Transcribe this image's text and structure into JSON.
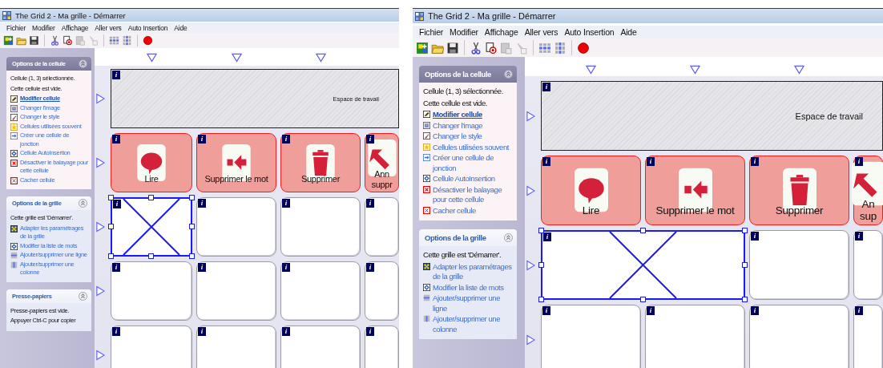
{
  "windows": [
    {
      "title": "The Grid 2 - Ma grille - Démarrer",
      "menu": [
        "Fichier",
        "Modifier",
        "Affichage",
        "Aller vers",
        "Auto Insertion",
        "Aide"
      ],
      "toolbar": [
        [
          {
            "kind": "new",
            "disabled": false
          },
          {
            "kind": "open",
            "disabled": false
          },
          {
            "kind": "save",
            "disabled": false
          }
        ],
        [
          {
            "kind": "cut",
            "disabled": false
          },
          {
            "kind": "copy",
            "disabled": false
          },
          {
            "kind": "paste",
            "disabled": true
          },
          {
            "kind": "paste-special",
            "disabled": true
          }
        ],
        [
          {
            "kind": "rows",
            "disabled": false
          },
          {
            "kind": "columns",
            "disabled": false
          }
        ],
        [
          {
            "kind": "record",
            "disabled": false
          }
        ]
      ],
      "panels": [
        {
          "title": "Options de la cellule",
          "highlighted": true,
          "lines": [
            {
              "kind": "text",
              "text": "Cellule (1, 3) sélectionnée."
            },
            {
              "kind": "text",
              "text": "Cette cellule est vide."
            },
            {
              "kind": "pencil",
              "text": "Modifier cellule",
              "bold": true
            },
            {
              "kind": "picture",
              "text": "Changer l'image",
              "bold": false
            },
            {
              "kind": "brush",
              "text": "Changer le style",
              "bold": false
            },
            {
              "kind": "star",
              "text": "Cellules utilisées souvent",
              "bold": false
            },
            {
              "kind": "arrow",
              "text": "Créer une cellule de jonction",
              "bold": false
            },
            {
              "kind": "diamond",
              "text": "Cellule AutoInsertion",
              "bold": false
            },
            {
              "kind": "cross-red",
              "text": "Désactiver le balayage pour cette cellule",
              "bold": false
            },
            {
              "kind": "cross-grey",
              "text": "Cacher cellule",
              "bold": false
            }
          ]
        },
        {
          "title": "Options de la grille",
          "highlighted": false,
          "lines": [
            {
              "kind": "text",
              "text": "Cette grille est 'Démarrer'."
            },
            {
              "kind": "checker",
              "text": "Adapter les paramétrages de la grille",
              "bold": false
            },
            {
              "kind": "diamond",
              "text": "Modifier la liste de mots",
              "bold": false
            },
            {
              "kind": "grid-row",
              "text": "Ajouter/supprimer une ligne",
              "bold": false
            },
            {
              "kind": "grid-col",
              "text": "Ajouter/supprimer une colonne",
              "bold": false
            }
          ]
        },
        {
          "title": "Presse-papiers",
          "highlighted": false,
          "lines": [
            {
              "kind": "text",
              "text": "Presse-papiers est vide."
            },
            {
              "kind": "text",
              "text": "Appuyer Ctrl-C pour copier"
            }
          ]
        }
      ],
      "workspace": {
        "badge": "i",
        "label": "Espace de travail"
      },
      "rows": [
        {
          "cells": [
            {
              "kind": "speech",
              "label": "Lire",
              "badge": "i",
              "selected": false,
              "wide": false
            },
            {
              "kind": "backspace",
              "label": "Supprimer le mot",
              "badge": "i",
              "selected": false,
              "wide": false
            },
            {
              "kind": "trash",
              "label": "Supprimer",
              "badge": "i",
              "selected": false,
              "wide": false
            },
            {
              "kind": "undo",
              "label": "Ann\nsuppr",
              "badge": "i",
              "selected": false,
              "wide": false
            }
          ]
        },
        {
          "cells": [
            {
              "kind": "blank",
              "badge": "i",
              "selected": true,
              "wide": false
            },
            {
              "kind": "blank",
              "badge": "i",
              "selected": false,
              "wide": false
            },
            {
              "kind": "blank",
              "badge": "i",
              "selected": false,
              "wide": false
            },
            {
              "kind": "blank",
              "badge": "i",
              "selected": false,
              "wide": false
            }
          ]
        },
        {
          "cells": [
            {
              "kind": "blank",
              "badge": "i",
              "selected": false,
              "wide": false
            },
            {
              "kind": "blank",
              "badge": "i",
              "selected": false,
              "wide": false
            },
            {
              "kind": "blank",
              "badge": "i",
              "selected": false,
              "wide": false
            },
            {
              "kind": "blank",
              "badge": "i",
              "selected": false,
              "wide": false
            }
          ]
        },
        {
          "cells": [
            {
              "kind": "blank",
              "badge": "i",
              "selected": false,
              "wide": false
            },
            {
              "kind": "blank",
              "badge": "i",
              "selected": false,
              "wide": false
            },
            {
              "kind": "blank",
              "badge": "i",
              "selected": false,
              "wide": false
            },
            {
              "kind": "blank",
              "badge": "i",
              "selected": false,
              "wide": false
            }
          ]
        }
      ]
    },
    {
      "title": "The Grid 2 - Ma grille - Démarrer",
      "menu": [
        "Fichier",
        "Modifier",
        "Affichage",
        "Aller vers",
        "Auto Insertion",
        "Aide"
      ],
      "toolbar": [
        [
          {
            "kind": "new",
            "disabled": false
          },
          {
            "kind": "open",
            "disabled": false
          },
          {
            "kind": "save",
            "disabled": false
          }
        ],
        [
          {
            "kind": "cut",
            "disabled": false
          },
          {
            "kind": "copy",
            "disabled": false
          },
          {
            "kind": "paste",
            "disabled": true
          },
          {
            "kind": "paste-special",
            "disabled": true
          }
        ],
        [
          {
            "kind": "rows",
            "disabled": false
          },
          {
            "kind": "columns",
            "disabled": false
          }
        ],
        [
          {
            "kind": "record",
            "disabled": false
          }
        ]
      ],
      "panels": [
        {
          "title": "Options de la cellule",
          "highlighted": true,
          "lines": [
            {
              "kind": "text",
              "text": "Cellule (1, 3) sélectionnée."
            },
            {
              "kind": "text",
              "text": "Cette cellule est vide."
            },
            {
              "kind": "pencil",
              "text": "Modifier cellule",
              "bold": true
            },
            {
              "kind": "picture",
              "text": "Changer l'image",
              "bold": false
            },
            {
              "kind": "brush",
              "text": "Changer le style",
              "bold": false
            },
            {
              "kind": "star",
              "text": "Cellules utilisées souvent",
              "bold": false
            },
            {
              "kind": "arrow",
              "text": "Créer une cellule de jonction",
              "bold": false
            },
            {
              "kind": "diamond",
              "text": "Cellule AutoInsertion",
              "bold": false
            },
            {
              "kind": "cross-red",
              "text": "Désactiver le balayage pour cette cellule",
              "bold": false
            },
            {
              "kind": "cross-grey",
              "text": "Cacher cellule",
              "bold": false
            }
          ]
        },
        {
          "title": "Options de la grille",
          "highlighted": false,
          "lines": [
            {
              "kind": "text",
              "text": "Cette grille est 'Démarrer'."
            },
            {
              "kind": "checker",
              "text": "Adapter les paramétrages de la grille",
              "bold": false
            },
            {
              "kind": "diamond",
              "text": "Modifier la liste de mots",
              "bold": false
            },
            {
              "kind": "grid-row",
              "text": "Ajouter/supprimer une ligne",
              "bold": false
            },
            {
              "kind": "grid-col",
              "text": "Ajouter/supprimer une colonne",
              "bold": false
            }
          ]
        }
      ],
      "workspace": {
        "badge": "i",
        "label": "Espace de travail"
      },
      "rows": [
        {
          "cells": [
            {
              "kind": "speech",
              "label": "Lire",
              "badge": "i",
              "selected": false,
              "wide": false
            },
            {
              "kind": "backspace",
              "label": "Supprimer le mot",
              "badge": "i",
              "selected": false,
              "wide": false
            },
            {
              "kind": "trash",
              "label": "Supprimer",
              "badge": "i",
              "selected": false,
              "wide": false
            },
            {
              "kind": "undo",
              "label": "An\nsup",
              "badge": "i",
              "selected": false,
              "wide": false
            }
          ]
        },
        {
          "cells": [
            {
              "kind": "blank",
              "badge": "i",
              "selected": true,
              "wide": true
            },
            "",
            {
              "kind": "blank",
              "badge": "i",
              "selected": false,
              "wide": false
            },
            {
              "kind": "blank",
              "badge": "i",
              "selected": false,
              "wide": false
            }
          ]
        },
        {
          "cells": [
            {
              "kind": "blank",
              "badge": "i",
              "selected": false,
              "wide": false
            },
            {
              "kind": "blank",
              "badge": "i",
              "selected": false,
              "wide": false
            },
            {
              "kind": "blank",
              "badge": "i",
              "selected": false,
              "wide": false
            },
            {
              "kind": "blank",
              "badge": "i",
              "selected": false,
              "wide": false
            }
          ]
        }
      ]
    }
  ]
}
